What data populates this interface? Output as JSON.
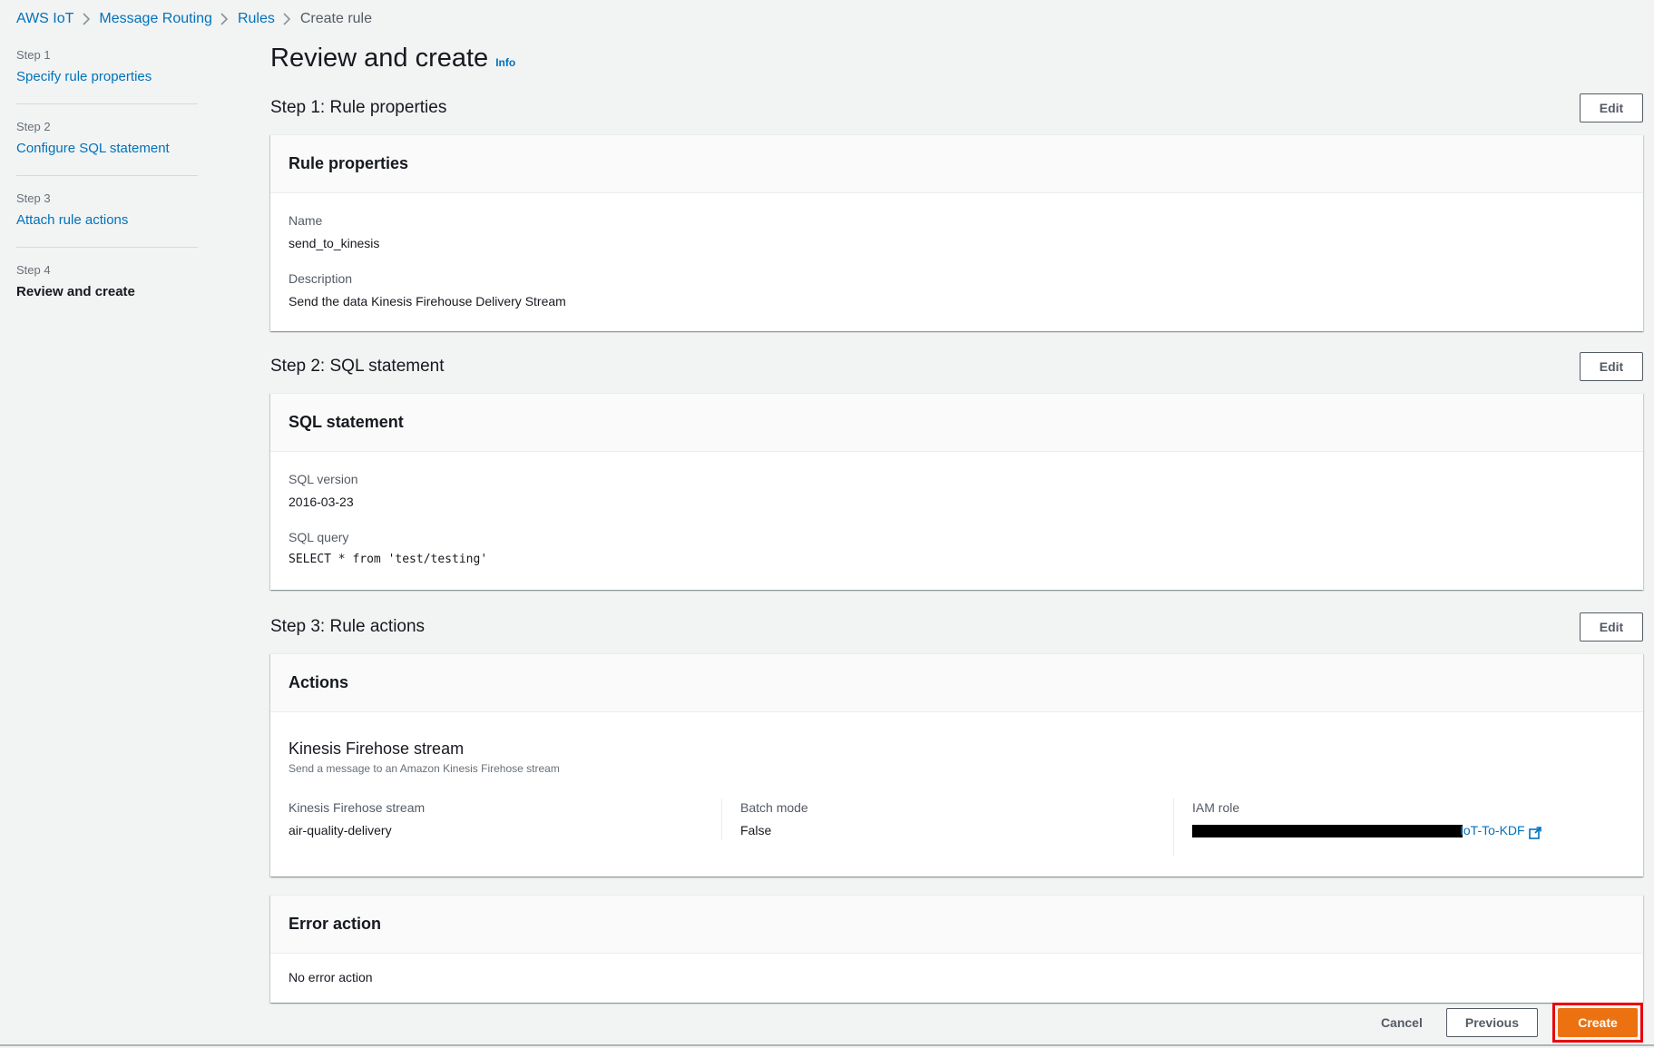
{
  "breadcrumb": [
    "AWS IoT",
    "Message Routing",
    "Rules",
    "Create rule"
  ],
  "steps": [
    {
      "num": "Step 1",
      "label": "Specify rule properties"
    },
    {
      "num": "Step 2",
      "label": "Configure SQL statement"
    },
    {
      "num": "Step 3",
      "label": "Attach rule actions"
    },
    {
      "num": "Step 4",
      "label": "Review and create"
    }
  ],
  "page": {
    "title": "Review and create",
    "info": "Info"
  },
  "edit_label": "Edit",
  "section1": {
    "heading": "Step 1: Rule properties",
    "panel_title": "Rule properties",
    "name_label": "Name",
    "name_value": "send_to_kinesis",
    "desc_label": "Description",
    "desc_value": "Send the data Kinesis Firehouse Delivery Stream"
  },
  "section2": {
    "heading": "Step 2: SQL statement",
    "panel_title": "SQL statement",
    "version_label": "SQL version",
    "version_value": "2016-03-23",
    "query_label": "SQL query",
    "query_value": "SELECT * from 'test/testing'"
  },
  "section3": {
    "heading": "Step 3: Rule actions",
    "panel_title": "Actions",
    "action_title": "Kinesis Firehose stream",
    "action_sub": "Send a message to an Amazon Kinesis Firehose stream",
    "stream_label": "Kinesis Firehose stream",
    "stream_value": "air-quality-delivery",
    "batch_label": "Batch mode",
    "batch_value": "False",
    "iam_label": "IAM role",
    "iam_value_visible": "IoT-To-KDF"
  },
  "error_action": {
    "panel_title": "Error action",
    "value": "No error action"
  },
  "footer": {
    "cancel": "Cancel",
    "previous": "Previous",
    "create": "Create"
  }
}
